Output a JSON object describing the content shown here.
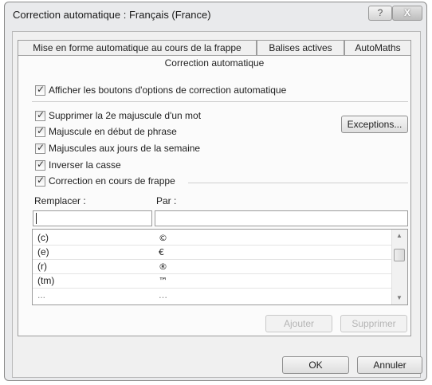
{
  "window": {
    "title": "Correction automatique : Français (France)",
    "help_glyph": "?",
    "close_glyph": "X"
  },
  "tabs": {
    "row1": [
      "Mise en forme automatique au cours de la frappe",
      "Balises actives",
      "AutoMaths"
    ],
    "active": "Correction automatique"
  },
  "options": {
    "show_buttons": "Afficher les boutons d'options de correction automatique",
    "two_initials": "Supprimer la 2e majuscule d'un mot",
    "capitalize_sentence": "Majuscule en début de phrase",
    "capitalize_days": "Majuscules aux jours de la semaine",
    "caps_lock": "Inverser la casse",
    "replace_typing": "Correction en cours de frappe"
  },
  "buttons": {
    "exceptions": "Exceptions...",
    "add": "Ajouter",
    "delete": "Supprimer",
    "ok": "OK",
    "cancel": "Annuler"
  },
  "replace": {
    "replace_label": "Remplacer :",
    "with_label": "Par :",
    "replace_value": "",
    "with_value": ""
  },
  "entries": [
    {
      "from": "(c)",
      "to": "©"
    },
    {
      "from": "(e)",
      "to": "€"
    },
    {
      "from": "(r)",
      "to": "®"
    },
    {
      "from": "(tm)",
      "to": "™"
    },
    {
      "from": "...",
      "to": "…"
    }
  ],
  "scrollbar": {
    "up_glyph": "▲",
    "down_glyph": "▼"
  }
}
